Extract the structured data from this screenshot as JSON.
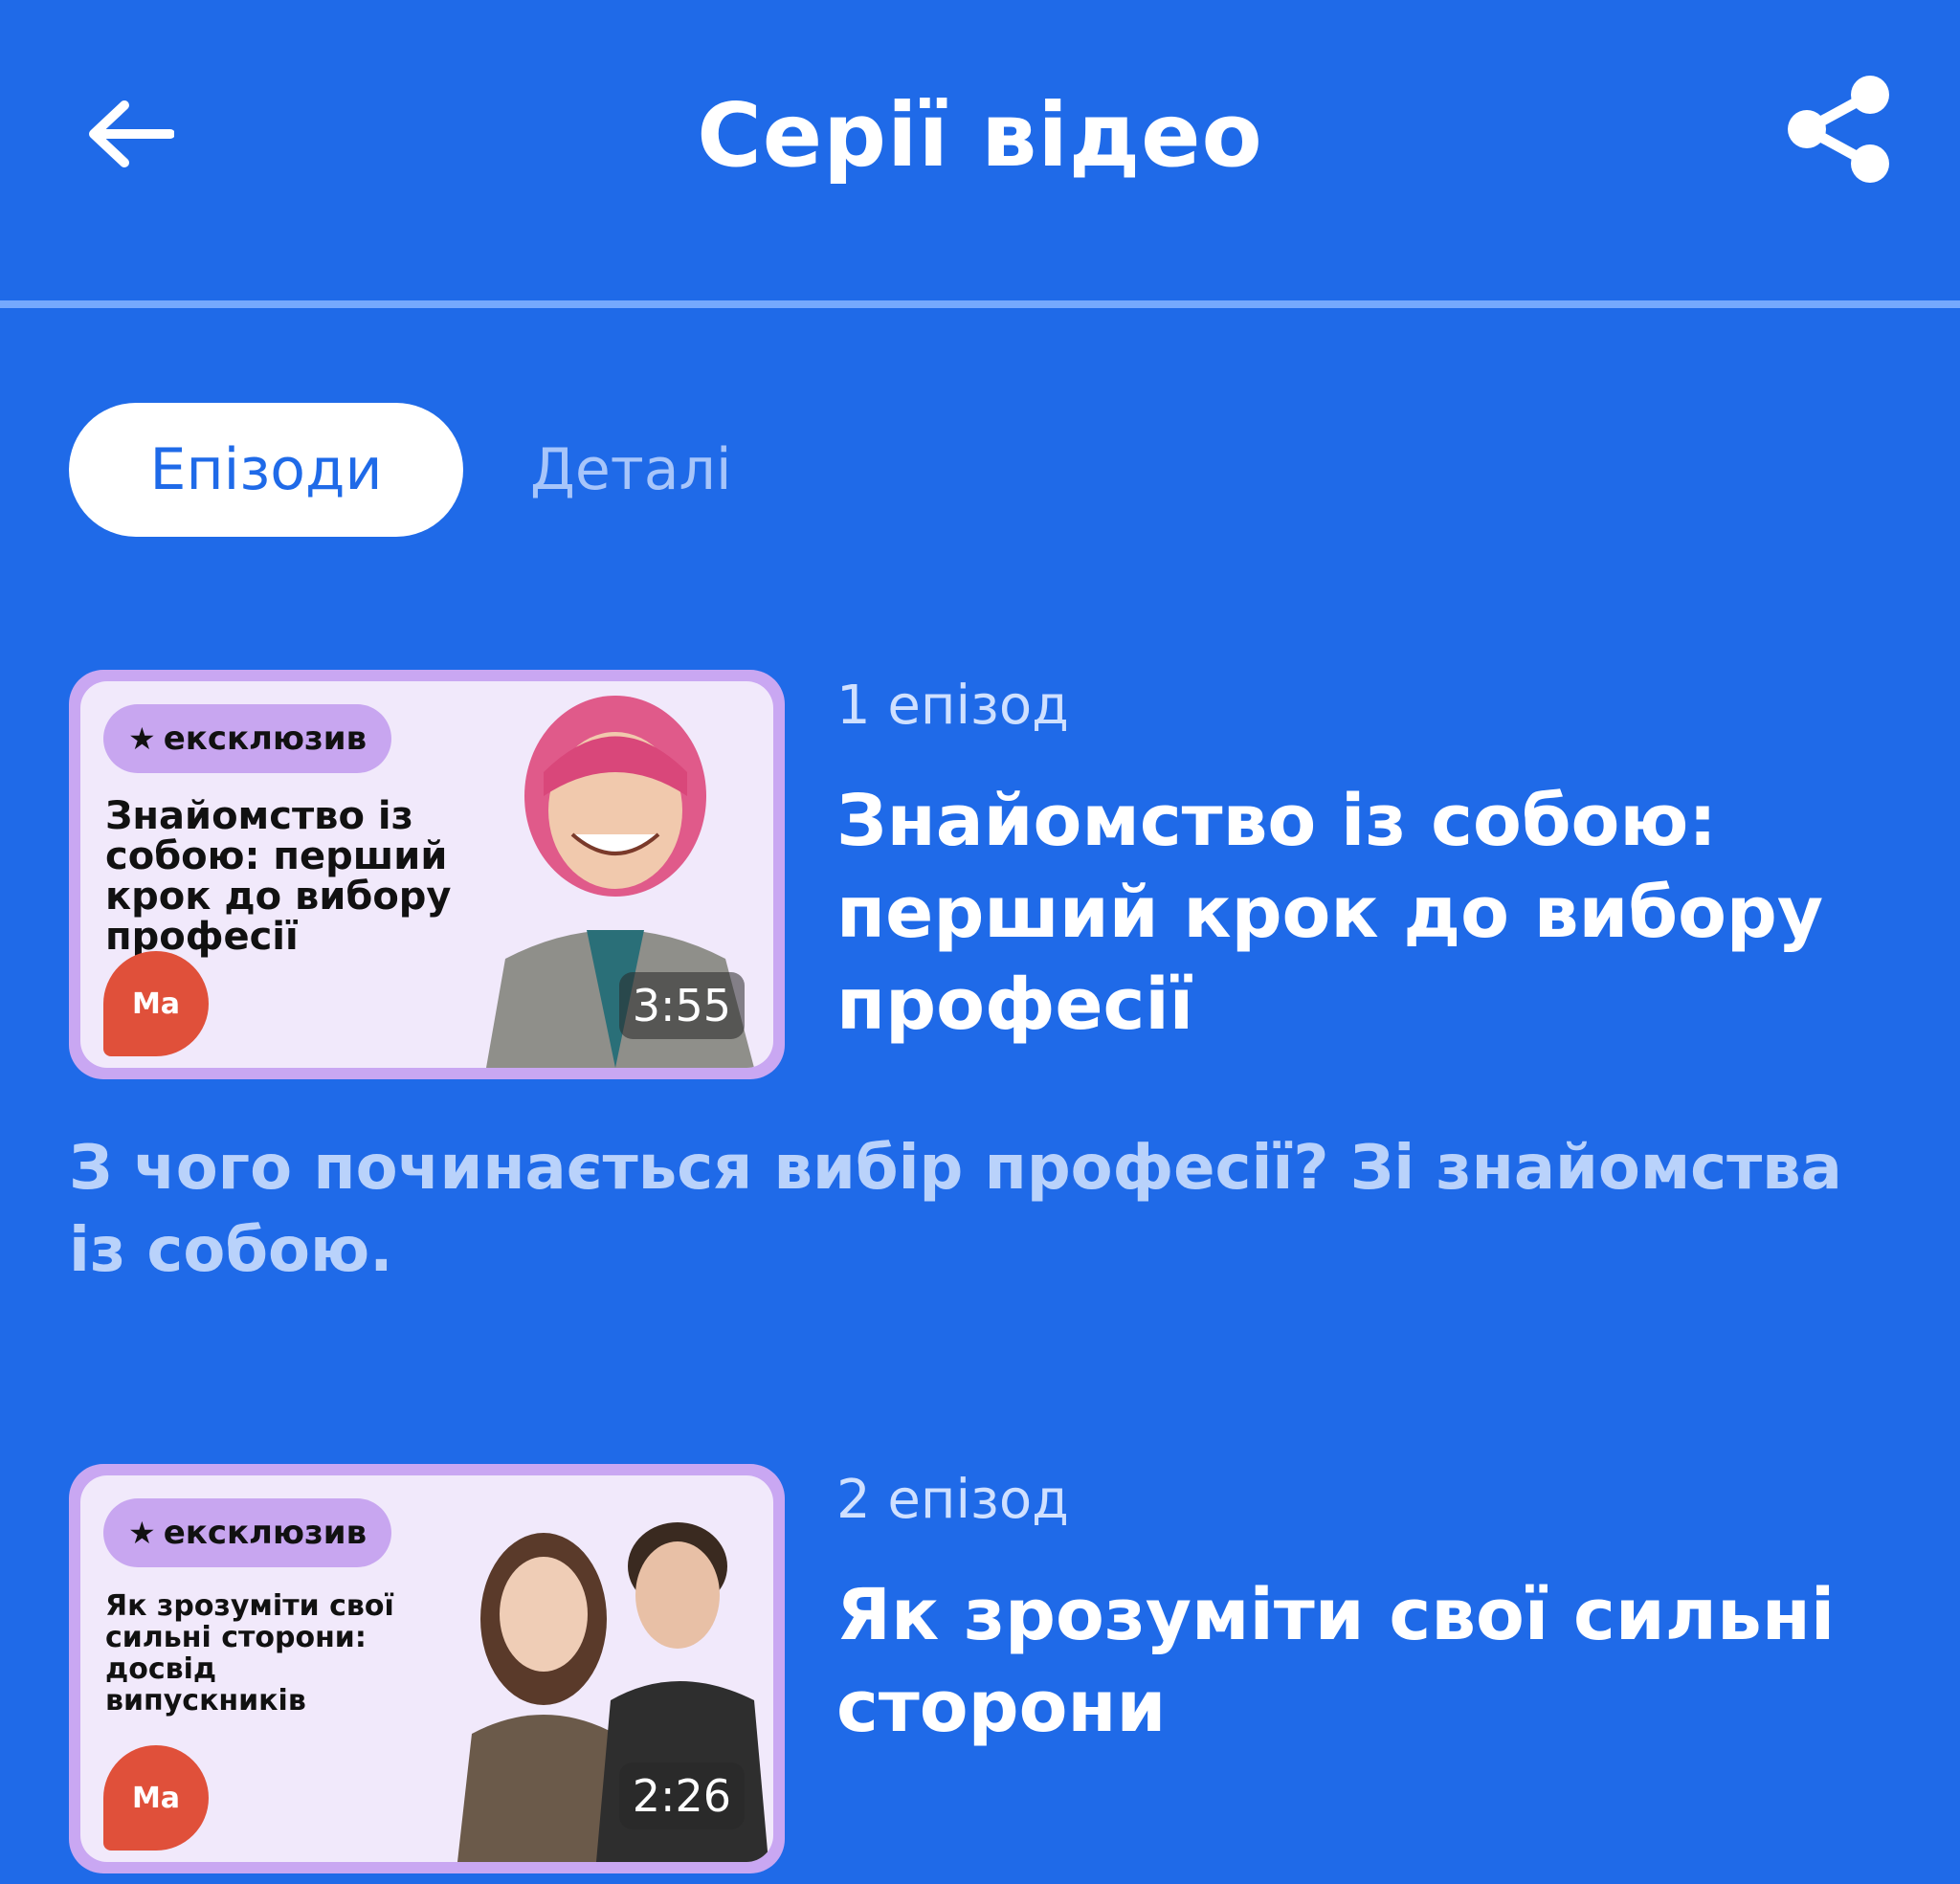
{
  "header": {
    "title": "Серії відео",
    "back_icon": "arrow-left-icon",
    "share_icon": "share-icon"
  },
  "tabs": [
    {
      "label": "Епізоди",
      "active": true
    },
    {
      "label": "Деталі",
      "active": false
    }
  ],
  "episodes": [
    {
      "number_label": "1 епізод",
      "title": "Знайомство із собою: перший крок до вибору професії",
      "description": "З чого починається вибір професії? Зі знайомства із собою.",
      "thumbnail": {
        "badge": "ексклюзив",
        "caption": "Знайомство із собою: перший крок до вибору професії",
        "logo": "Ма",
        "duration": "3:55"
      }
    },
    {
      "number_label": "2 епізод",
      "title": "Як зрозуміти свої сильні сторони",
      "thumbnail": {
        "badge": "ексклюзив",
        "caption": "Як зрозуміти свої сильні сторони: досвід випускників",
        "logo": "Ма",
        "duration": "2:26"
      }
    }
  ],
  "colors": {
    "background": "#1f6ae8",
    "tab_active_bg": "#ffffff",
    "thumb_border": "#c9a7f2",
    "logo": "#e0503a"
  }
}
